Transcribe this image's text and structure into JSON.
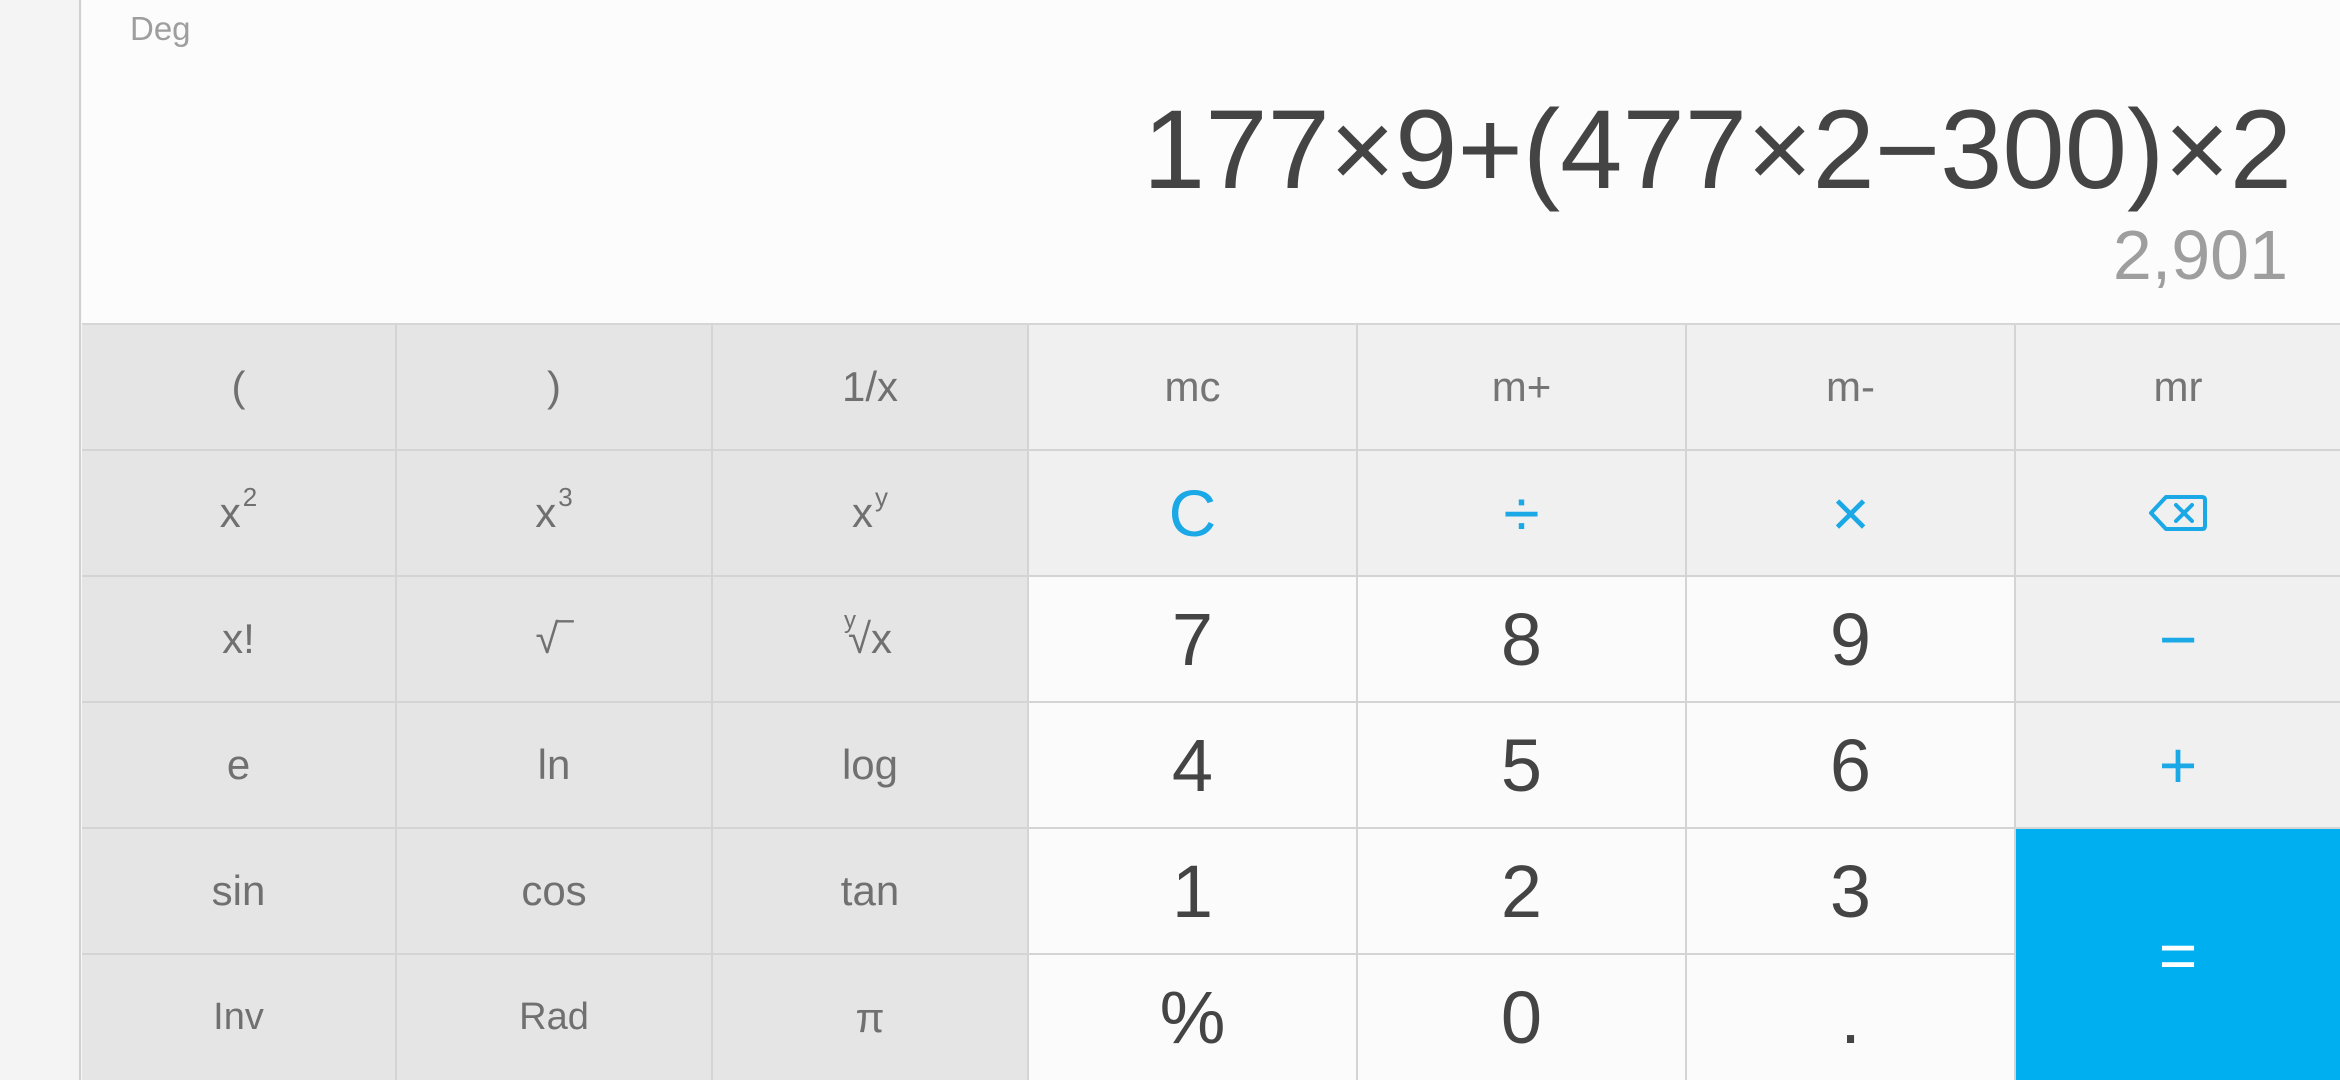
{
  "display": {
    "angle_mode": "Deg",
    "expression": "177×9+(477×2−300)×2",
    "result": "2,901"
  },
  "keys": {
    "open_paren": "(",
    "close_paren": ")",
    "reciprocal": "1/x",
    "mc": "mc",
    "m_plus": "m+",
    "m_minus": "m-",
    "mr": "mr",
    "square_base": "x",
    "square_exp": "2",
    "cube_base": "x",
    "cube_exp": "3",
    "power_base": "x",
    "power_exp": "y",
    "clear": "C",
    "divide": "÷",
    "multiply": "×",
    "factorial": "x!",
    "sqrt": "√‾",
    "yroot_index": "y",
    "yroot_radical": "√x",
    "d7": "7",
    "d8": "8",
    "d9": "9",
    "minus": "−",
    "e": "e",
    "ln": "ln",
    "log": "log",
    "d4": "4",
    "d5": "5",
    "d6": "6",
    "plus": "+",
    "sin": "sin",
    "cos": "cos",
    "tan": "tan",
    "d1": "1",
    "d2": "2",
    "d3": "3",
    "equals": "=",
    "inv": "Inv",
    "rad": "Rad",
    "pi": "π",
    "percent": "%",
    "d0": "0",
    "decimal": "."
  },
  "icons": {
    "backspace": "backspace-icon"
  },
  "colors": {
    "accent": "#1aa8e6",
    "equals_bg": "#00aff0",
    "scientific_bg": "#e5e5e5",
    "operator_bg": "#f0f0f0",
    "number_bg": "#fbfbfb",
    "display_text": "#444444",
    "result_text": "#9e9e9e"
  }
}
